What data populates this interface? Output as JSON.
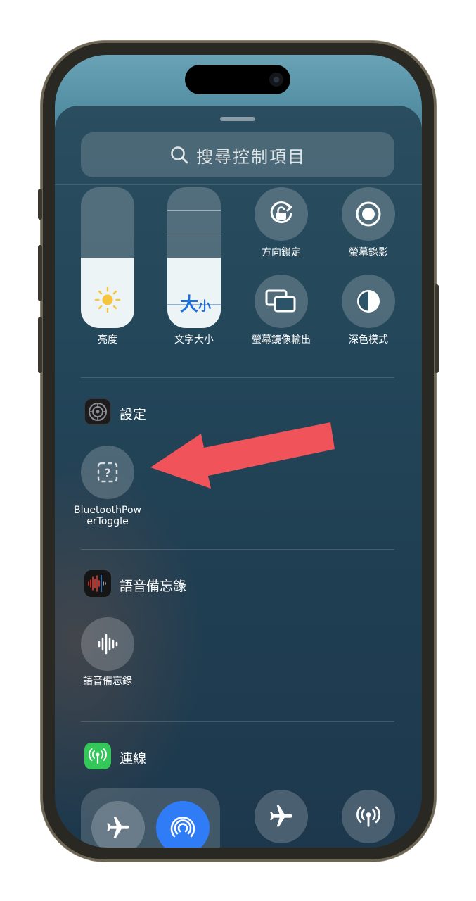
{
  "search": {
    "placeholder": "搜尋控制項目"
  },
  "controls": {
    "brightness_label": "亮度",
    "brightness_level": 0.5,
    "text_size_label": "文字大小",
    "text_size_glyph_big": "大",
    "text_size_glyph_small": "小",
    "text_size_level": 0.5,
    "orientation_lock_label": "方向鎖定",
    "screen_record_label": "螢幕錄影",
    "screen_mirroring_label": "螢幕鏡像輸出",
    "dark_mode_label": "深色模式"
  },
  "sections": {
    "settings": {
      "title": "設定",
      "toggle_label_line1": "BluetoothPow",
      "toggle_label_line2": "erToggle",
      "toggle_icon": "question-mark-icon"
    },
    "voice_memos": {
      "title": "語音備忘錄",
      "toggle_label": "語音備忘錄",
      "toggle_icon": "waveform-icon"
    },
    "connectivity": {
      "title": "連線",
      "icon_color": "#34c759"
    }
  },
  "colors": {
    "airdrop_blue": "#2f7cf6",
    "arrow_red": "#f0545a",
    "sun_yellow": "#f6c53b",
    "text_blue": "#1f6fd6"
  }
}
